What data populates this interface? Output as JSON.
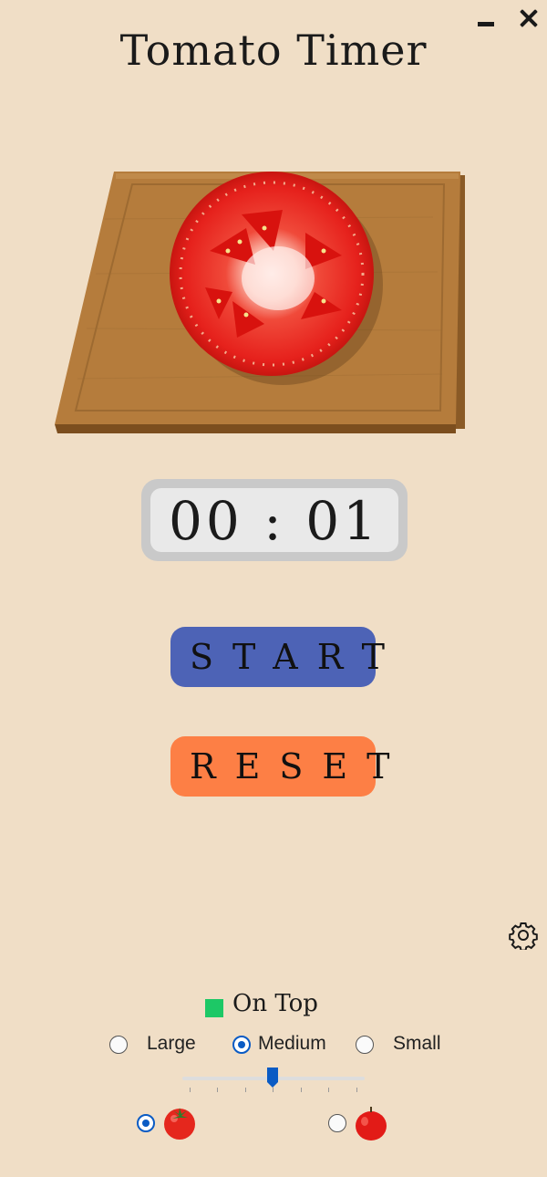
{
  "window": {
    "title": "Tomato Timer",
    "minimize_icon": "minimize-icon",
    "close_icon": "close-icon"
  },
  "timer": {
    "display": "00 : 01"
  },
  "controls": {
    "start_label": "START",
    "reset_label": "RESET",
    "start_color": "#4d63b6",
    "reset_color": "#fd7f45"
  },
  "settings": {
    "gear_icon": "gear-icon",
    "on_top_label": "On Top",
    "on_top_color": "#1dc866",
    "size_options": [
      {
        "label": "Large",
        "selected": false
      },
      {
        "label": "Medium",
        "selected": true
      },
      {
        "label": "Small",
        "selected": false
      }
    ],
    "slider_value": 0.5,
    "image_options": [
      {
        "icon": "whole-tomato-icon",
        "selected": true
      },
      {
        "icon": "red-tomato-icon",
        "selected": false
      }
    ]
  }
}
